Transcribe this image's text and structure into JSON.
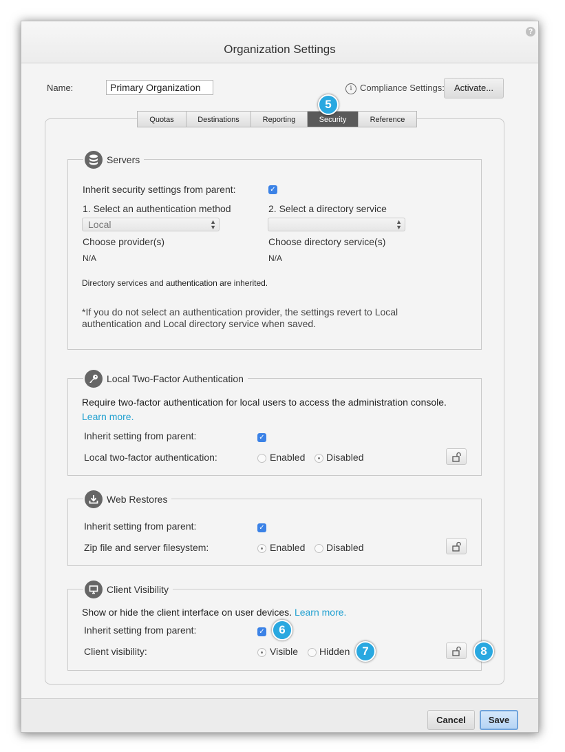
{
  "dialog": {
    "title": "Organization Settings",
    "help_icon": "?",
    "name_label": "Name:",
    "name_value": "Primary Organization",
    "compliance_label": "Compliance Settings:",
    "activate_label": "Activate..."
  },
  "tabs": [
    {
      "label": "Quotas"
    },
    {
      "label": "Destinations"
    },
    {
      "label": "Reporting"
    },
    {
      "label": "Security",
      "active": true
    },
    {
      "label": "Reference"
    }
  ],
  "servers": {
    "title": "Servers",
    "inherit_label": "Inherit security settings from parent:",
    "inherit_checked": true,
    "auth_method_label": "1. Select an authentication method",
    "auth_method_value": "Local",
    "directory_service_label": "2. Select a directory service",
    "directory_service_value": "",
    "providers_label": "Choose provider(s)",
    "providers_value": "N/A",
    "directory_services_label": "Choose directory service(s)",
    "directory_services_value": "N/A",
    "inherited_note": "Directory services and authentication are inherited.",
    "revert_note_line1": "*If you do not select an authentication provider, the settings revert to Local",
    "revert_note_line2": "authentication and Local directory service when saved."
  },
  "two_factor": {
    "title": "Local Two-Factor Authentication",
    "description": "Require two-factor authentication for local users to access the administration console.",
    "learn_more": "Learn more.",
    "inherit_label": "Inherit setting from parent:",
    "inherit_checked": true,
    "setting_label": "Local two-factor authentication:",
    "option_enabled": "Enabled",
    "option_disabled": "Disabled",
    "selected": "Disabled"
  },
  "web_restores": {
    "title": "Web Restores",
    "inherit_label": "Inherit setting from parent:",
    "inherit_checked": true,
    "setting_label": "Zip file and server filesystem:",
    "option_enabled": "Enabled",
    "option_disabled": "Disabled",
    "selected": "Enabled"
  },
  "client_visibility": {
    "title": "Client Visibility",
    "description": "Show or hide the client interface on user devices.",
    "learn_more": "Learn more.",
    "inherit_label": "Inherit setting from parent:",
    "inherit_checked": true,
    "setting_label": "Client visibility:",
    "option_visible": "Visible",
    "option_hidden": "Hidden",
    "selected": "Visible"
  },
  "callouts": {
    "tab": "5",
    "inherit": "6",
    "visibility": "7",
    "lock": "8"
  },
  "footer": {
    "cancel_label": "Cancel",
    "save_label": "Save"
  },
  "colors": {
    "accent": "#29a8e0",
    "checkbox": "#3b82e6",
    "link": "#20a0d0",
    "active_tab": "#5a5a5a"
  },
  "icons": {
    "servers": "database-icon",
    "two_factor": "key-icon",
    "web_restores": "download-icon",
    "client_visibility": "monitor-icon",
    "lock": "unlock-icon"
  }
}
